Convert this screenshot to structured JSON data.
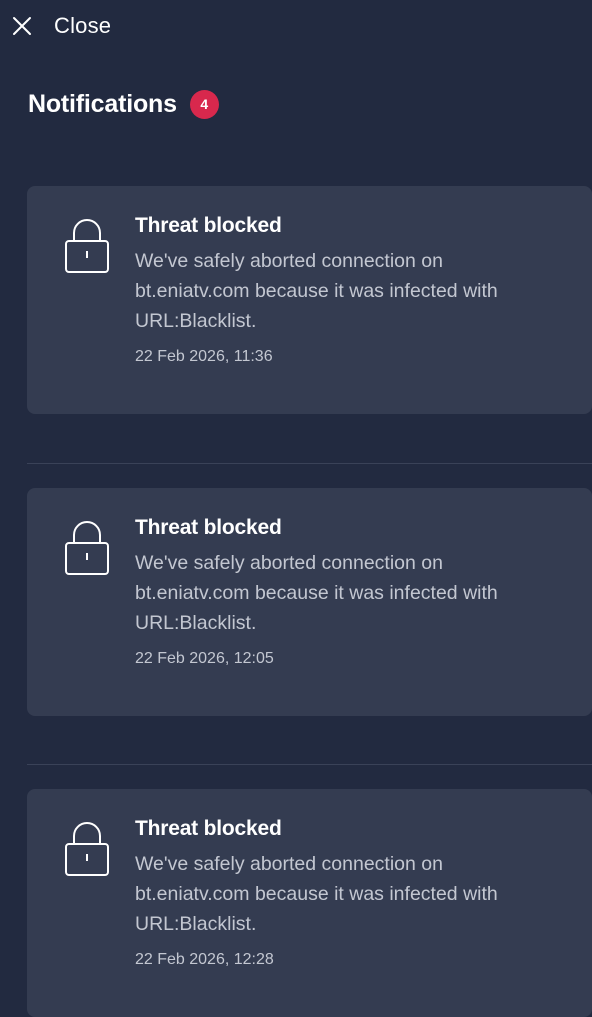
{
  "topbar": {
    "close_label": "Close"
  },
  "header": {
    "title": "Notifications",
    "badge_count": "4"
  },
  "notifications": [
    {
      "icon": "lock-icon",
      "title": "Threat blocked",
      "body": "We've safely aborted connection on bt.eniatv.com because it was infected with URL:Blacklist.",
      "date": "22 Feb 2026, 11:36"
    },
    {
      "icon": "lock-icon",
      "title": "Threat blocked",
      "body": "We've safely aborted connection on bt.eniatv.com because it was infected with URL:Blacklist.",
      "date": "22 Feb 2026, 12:05"
    },
    {
      "icon": "lock-icon",
      "title": "Threat blocked",
      "body": "We've safely aborted connection on bt.eniatv.com because it was infected with URL:Blacklist.",
      "date": "22 Feb 2026, 12:28"
    }
  ],
  "colors": {
    "background": "#222a40",
    "card": "#343c51",
    "badge": "#d8284d",
    "text_primary": "#ffffff",
    "text_secondary": "#c3c7d1"
  }
}
